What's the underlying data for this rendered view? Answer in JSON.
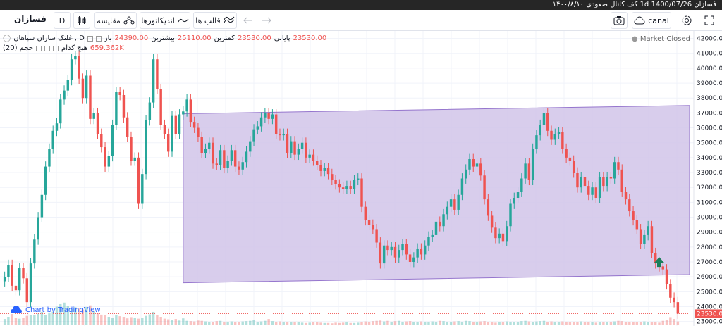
{
  "window": {
    "title": "فسازان  1400/07/26 1d کف کانال صعودی  ۱۴۰۰/۸/۱۰"
  },
  "toolbar": {
    "symbol": "فسازان",
    "interval": "D",
    "compare_label": "مقایسه",
    "indicators_label": "اندیکاتورها",
    "templates_label": "قالب ها",
    "cloud_label": "canal"
  },
  "legend": {
    "title": "غلتک سازان سپاهان , D",
    "open_label": "باز",
    "open_value": "24390.00",
    "high_label": "بیشترین",
    "high_value": "25110.00",
    "low_label": "کمترین",
    "low_value": "23530.00",
    "close_label": "پایانی",
    "close_value": "23530.00",
    "volume_label": "حجم (20)",
    "volume_sub_label": "هیچ کدام",
    "volume_value": "659.362K"
  },
  "status": {
    "market_closed": "Market Closed"
  },
  "branding": {
    "text": "Chart by TradingView"
  },
  "chart_data": {
    "type": "candlestick",
    "y_ticks": [
      "42000.00",
      "41000.00",
      "40000.00",
      "39000.00",
      "38000.00",
      "37000.00",
      "36000.00",
      "35000.00",
      "34000.00",
      "33000.00",
      "32000.00",
      "31000.00",
      "30000.00",
      "29000.00",
      "28000.00",
      "27000.00",
      "26000.00",
      "25000.00",
      "24000.00",
      "23000.00"
    ],
    "last_price_label": "23530.00",
    "ylim": [
      22700,
      42500
    ],
    "colors": {
      "up": "#26a69a",
      "down": "#ef5350",
      "channel_fill": "#d1c4e9",
      "channel_line": "#9575cd"
    },
    "closes": [
      26000,
      26800,
      25400,
      25100,
      26600,
      25900,
      24300,
      26900,
      28500,
      30000,
      31500,
      33400,
      34600,
      35800,
      36300,
      37900,
      38500,
      39200,
      40600,
      40800,
      39300,
      38000,
      39500,
      36600,
      37000,
      35600,
      34700,
      33400,
      34100,
      36200,
      38400,
      38200,
      36700,
      35400,
      33800,
      34000,
      30900,
      32900,
      36500,
      37700,
      40600,
      38600,
      36200,
      35600,
      34400,
      36800,
      35600,
      36900,
      37100,
      37900,
      36400,
      36000,
      35400,
      34300,
      34600,
      35000,
      33600,
      33500,
      34500,
      33300,
      33800,
      34500,
      33400,
      33200,
      33700,
      34400,
      35100,
      35900,
      36100,
      36700,
      37000,
      36600,
      36900,
      35600,
      35500,
      35600,
      34300,
      35100,
      34200,
      34600,
      35000,
      34000,
      34200,
      33800,
      33500,
      33100,
      33300,
      32900,
      32500,
      32200,
      32000,
      31900,
      32100,
      31900,
      32500,
      32600,
      30700,
      29800,
      29500,
      29200,
      28300,
      26900,
      28100,
      27800,
      28000,
      27300,
      27800,
      28200,
      27500,
      27000,
      27300,
      27900,
      27500,
      28100,
      28700,
      28800,
      29700,
      29400,
      30200,
      30700,
      31200,
      30500,
      31500,
      32600,
      33200,
      33900,
      33400,
      33600,
      32800,
      31200,
      30100,
      29300,
      28600,
      28900,
      28400,
      29400,
      30900,
      31300,
      31700,
      32600,
      33600,
      32500,
      34600,
      35500,
      36200,
      37000,
      35800,
      35200,
      35600,
      35700,
      34600,
      34000,
      33800,
      33000,
      32000,
      32700,
      32100,
      31500,
      32000,
      31300,
      32700,
      32100,
      32700,
      32600,
      33700,
      33200,
      31700,
      31200,
      30400,
      29800,
      29200,
      28200,
      28800,
      29400,
      27600,
      26900,
      26700,
      26500,
      25500,
      24600,
      24300,
      23530
    ],
    "volumes": [
      0.18,
      0.25,
      0.34,
      0.22,
      0.19,
      0.22,
      0.28,
      0.31,
      0.3,
      0.35,
      0.41,
      0.3,
      0.39,
      0.42,
      0.58,
      0.66,
      0.71,
      0.61,
      0.51,
      0.56,
      0.52,
      0.49,
      0.57,
      0.62,
      0.44,
      0.36,
      0.32,
      0.31,
      0.25,
      0.22,
      0.3,
      0.27,
      0.25,
      0.2,
      0.24,
      0.21,
      0.19,
      0.22,
      0.28,
      0.33,
      0.41,
      0.3,
      0.25,
      0.19,
      0.17,
      0.15,
      0.18,
      0.13,
      0.2,
      0.12,
      0.11,
      0.1,
      0.13,
      0.12,
      0.1,
      0.08,
      0.09,
      0.11,
      0.12,
      0.08,
      0.07,
      0.1,
      0.09,
      0.08,
      0.1,
      0.11,
      0.12,
      0.14,
      0.09,
      0.1,
      0.12,
      0.18,
      0.11,
      0.09,
      0.1,
      0.07,
      0.08,
      0.07,
      0.08,
      0.09,
      0.06,
      0.05,
      0.06,
      0.08,
      0.07,
      0.06,
      0.05,
      0.05,
      0.04,
      0.06,
      0.05,
      0.06,
      0.07,
      0.05,
      0.05,
      0.06,
      0.08,
      0.1,
      0.09,
      0.11,
      0.12,
      0.13,
      0.1,
      0.12,
      0.09,
      0.11,
      0.12,
      0.09,
      0.1,
      0.11,
      0.09,
      0.08,
      0.1,
      0.09,
      0.08,
      0.1,
      0.09,
      0.12,
      0.11,
      0.08,
      0.09,
      0.1,
      0.11,
      0.09,
      0.12,
      0.11,
      0.08,
      0.09,
      0.1,
      0.11,
      0.09,
      0.08,
      0.06,
      0.07,
      0.09,
      0.1,
      0.08,
      0.07,
      0.09,
      0.11,
      0.12,
      0.1,
      0.09,
      0.1,
      0.11,
      0.12,
      0.09,
      0.1,
      0.08,
      0.09,
      0.1,
      0.08,
      0.07,
      0.09,
      0.08,
      0.1,
      0.09,
      0.08,
      0.07,
      0.06,
      0.08,
      0.07,
      0.09,
      0.08,
      0.1,
      0.12,
      0.11,
      0.08,
      0.09,
      0.07,
      0.08,
      0.09,
      0.1,
      0.08,
      0.09,
      0.07,
      0.06,
      0.12,
      0.15,
      0.24,
      0.18,
      0.1
    ]
  }
}
